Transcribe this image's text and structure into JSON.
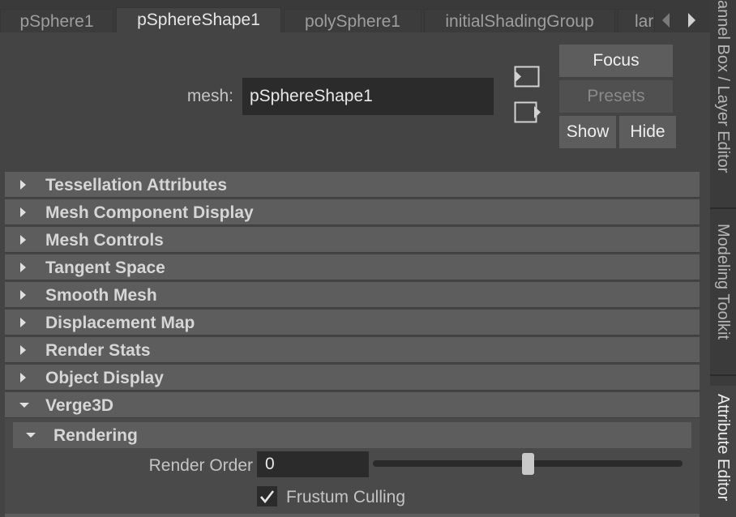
{
  "tabs": [
    {
      "label": "pSphere1",
      "active": false
    },
    {
      "label": "pSphereShape1",
      "active": true
    },
    {
      "label": "polySphere1",
      "active": false
    },
    {
      "label": "initialShadingGroup",
      "active": false
    },
    {
      "label": "lar",
      "active": false
    }
  ],
  "tab_nav": {
    "prev_icon": "triangle-left-icon",
    "next_icon": "triangle-right-icon"
  },
  "dock": {
    "tabs": [
      {
        "label": "annel Box / Layer Editor",
        "active": false
      },
      {
        "label": "Modeling Toolkit",
        "active": false
      },
      {
        "label": "Attribute Editor",
        "active": true
      }
    ]
  },
  "mesh": {
    "label": "mesh:",
    "value": "pSphereShape1",
    "select_icon": "select-node-icon",
    "load_icon": "load-node-icon"
  },
  "buttons": {
    "focus": "Focus",
    "presets": "Presets",
    "show": "Show",
    "hide": "Hide"
  },
  "sections": [
    {
      "title": "Tessellation Attributes",
      "expanded": false
    },
    {
      "title": "Mesh Component Display",
      "expanded": false
    },
    {
      "title": "Mesh Controls",
      "expanded": false
    },
    {
      "title": "Tangent Space",
      "expanded": false
    },
    {
      "title": "Smooth Mesh",
      "expanded": false
    },
    {
      "title": "Displacement Map",
      "expanded": false
    },
    {
      "title": "Render Stats",
      "expanded": false
    },
    {
      "title": "Object Display",
      "expanded": false
    },
    {
      "title": "Verge3D",
      "expanded": true
    }
  ],
  "verge3d": {
    "subsection": {
      "title": "Rendering",
      "expanded": true
    },
    "render_order": {
      "label": "Render Order",
      "value": "0",
      "slider_fraction": 0.5
    },
    "frustum_culling": {
      "label": "Frustum Culling",
      "checked": true
    }
  },
  "colors": {
    "background": "#444444",
    "frame_header": "#5d5d5d",
    "field": "#2b2b2b",
    "text": "#c4c4c4"
  }
}
